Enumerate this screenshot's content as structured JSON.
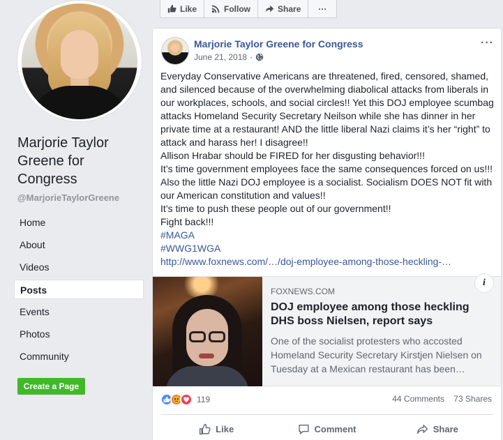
{
  "sidebar": {
    "page_name": "Marjorie Taylor Greene for Congress",
    "handle": "@MarjorieTaylorGreene",
    "nav": [
      {
        "label": "Home",
        "active": false
      },
      {
        "label": "About",
        "active": false
      },
      {
        "label": "Videos",
        "active": false
      },
      {
        "label": "Posts",
        "active": true
      },
      {
        "label": "Events",
        "active": false
      },
      {
        "label": "Photos",
        "active": false
      },
      {
        "label": "Community",
        "active": false
      }
    ],
    "create_page": "Create a Page"
  },
  "actionbar": {
    "like": "Like",
    "follow": "Follow",
    "share": "Share",
    "more": "···"
  },
  "post": {
    "author": "Marjorie Taylor Greene for Congress",
    "date": "June 21, 2018",
    "more": "···",
    "lines": [
      "Everyday Conservative Americans are threatened, fired, censored, shamed, and silenced because of the overwhelming diabolical attacks from liberals in our workplaces, schools, and social circles!! Yet this DOJ employee scumbag attacks Homeland Security Secretary Neilson while she has dinner in her private time at a restaurant! AND the little liberal Nazi claims it’s her “right” to attack and harass her! I disagree!!",
      "Allison Hrabar should be FIRED for her disgusting behavior!!!",
      "It’s time government employees face the same consequences forced on us!!! Also the little Nazi DOJ employee is a socialist. Socialism DOES NOT fit with our American constitution and values!!",
      "It’s time to push these people out of our government!!",
      "Fight back!!!"
    ],
    "hashtags": [
      "#MAGA",
      "#WWG1WGA"
    ],
    "url": "http://www.foxnews.com/…/doj-employee-among-those-heckling-…",
    "preview": {
      "source": "FOXNEWS.COM",
      "title": "DOJ employee among those heckling DHS boss Nielsen, report says",
      "description": "One of the socialist protesters who accosted Homeland Security Secretary Kirstjen Nielsen on Tuesday at a Mexican restaurant has been…",
      "info": "i"
    },
    "reaction_count": "119",
    "comments": "44 Comments",
    "shares": "73 Shares",
    "actions": {
      "like": "Like",
      "comment": "Comment",
      "share": "Share"
    }
  }
}
